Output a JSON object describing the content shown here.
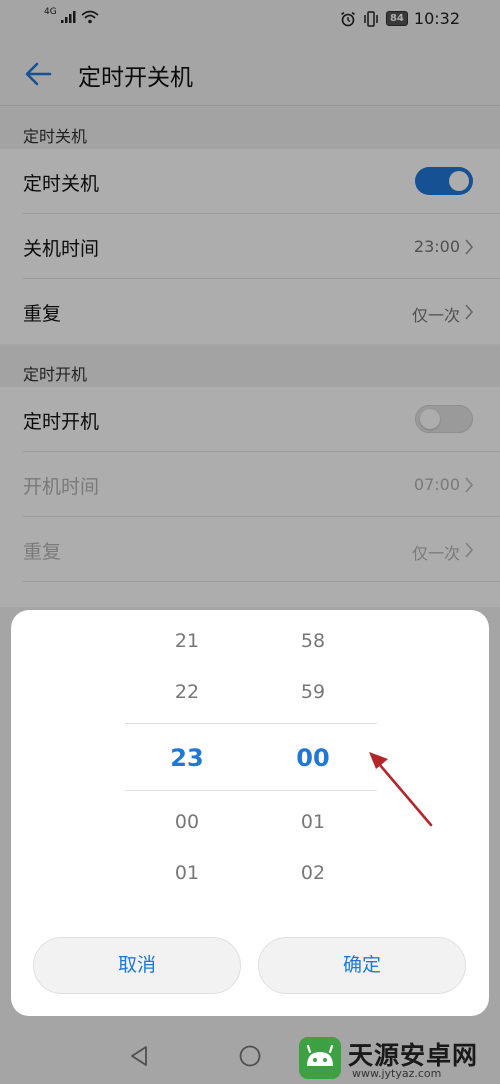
{
  "status_bar": {
    "network": "4G",
    "battery": "84",
    "time": "10:32"
  },
  "header": {
    "title": "定时开关机"
  },
  "shutdown_section": {
    "header": "定时关机",
    "rows": [
      {
        "label": "定时关机",
        "toggle": "on"
      },
      {
        "label": "关机时间",
        "value": "23:00"
      },
      {
        "label": "重复",
        "value": "仅一次"
      }
    ]
  },
  "startup_section": {
    "header": "定时开机",
    "rows": [
      {
        "label": "定时开机",
        "toggle": "off"
      },
      {
        "label": "开机时间",
        "value": "07:00"
      },
      {
        "label": "重复",
        "value": "仅一次"
      }
    ]
  },
  "dialog": {
    "hours": [
      "21",
      "22",
      "23",
      "00",
      "01"
    ],
    "minutes": [
      "58",
      "59",
      "00",
      "01",
      "02"
    ],
    "selected_hour": "23",
    "selected_minute": "00",
    "cancel_label": "取消",
    "confirm_label": "确定"
  },
  "watermark": {
    "name": "天源安卓网",
    "url": "www.jytyaz.com"
  },
  "colors": {
    "accent": "#1f78d9",
    "arrow": "#b3262a",
    "watermark_green": "#3da043"
  }
}
